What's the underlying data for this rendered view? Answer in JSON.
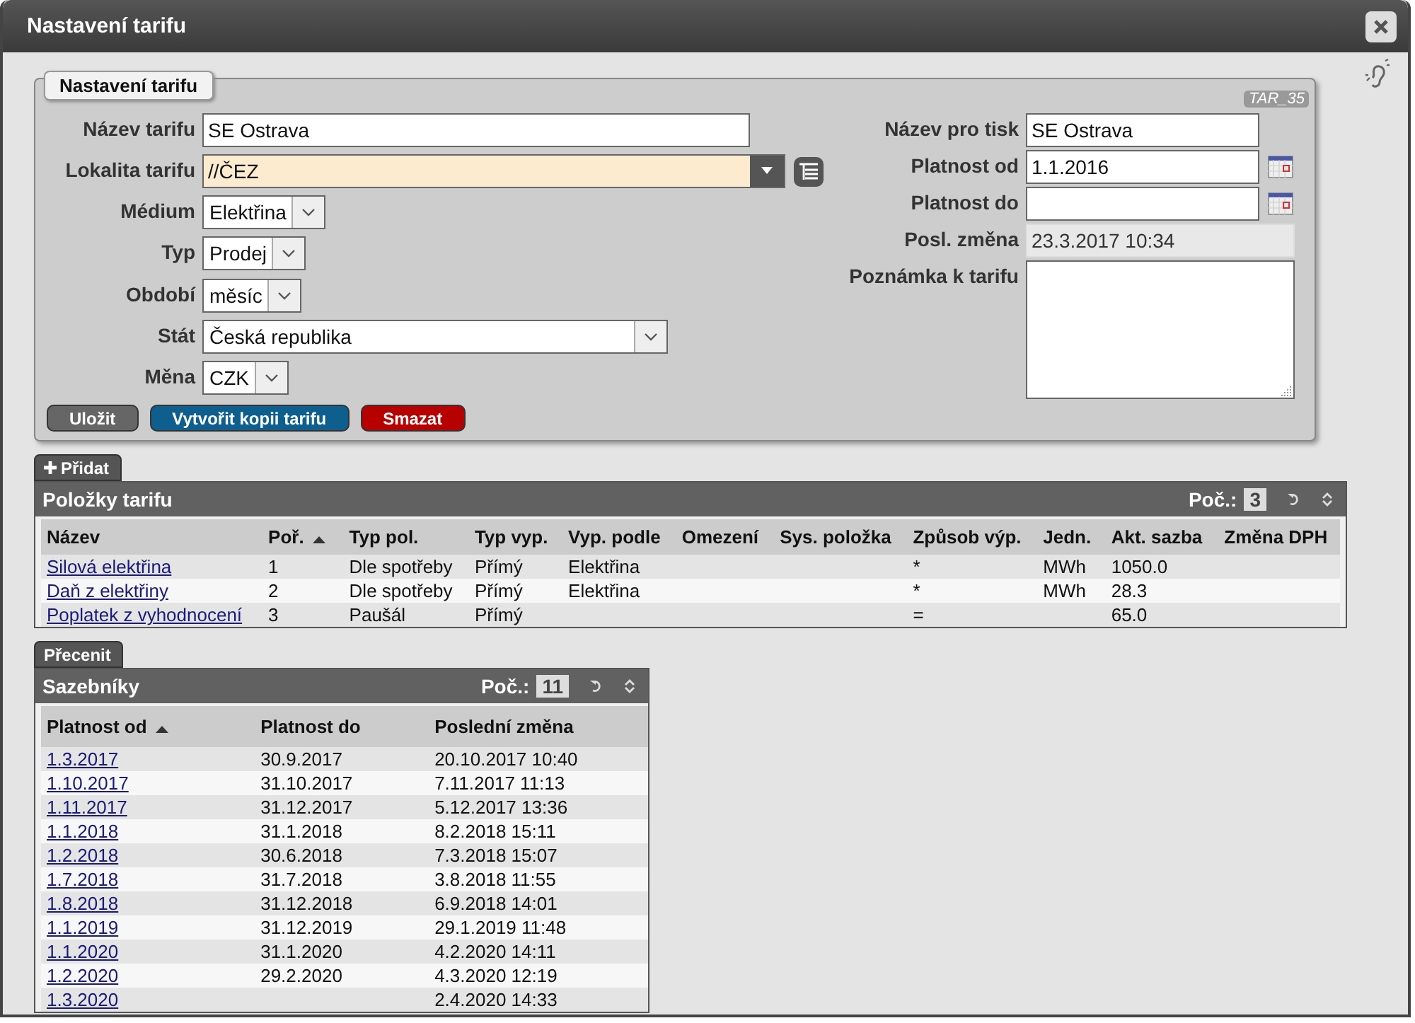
{
  "window": {
    "title": "Nastavení tarifu"
  },
  "panel": {
    "legend": "Nastavení tarifu",
    "code": "TAR_35",
    "left_fields": [
      {
        "label": "Název tarifu",
        "value": "SE Ostrava",
        "kind": "text",
        "highlighted": false
      },
      {
        "label": "Lokalita tarifu",
        "value": "//ČEZ",
        "kind": "combo",
        "highlighted": true
      },
      {
        "label": "Médium",
        "value": "Elektřina",
        "kind": "select",
        "highlighted": false
      },
      {
        "label": "Typ",
        "value": "Prodej",
        "kind": "select",
        "highlighted": false
      },
      {
        "label": "Období",
        "value": "měsíc",
        "kind": "select",
        "highlighted": false
      },
      {
        "label": "Stát",
        "value": "Česká republika",
        "kind": "wideselect",
        "highlighted": false
      },
      {
        "label": "Měna",
        "value": "CZK",
        "kind": "select",
        "highlighted": false
      }
    ],
    "right_fields": [
      {
        "label": "Název pro tisk",
        "value": "SE Ostrava",
        "kind": "text"
      },
      {
        "label": "Platnost od",
        "value": "1.1.2016",
        "kind": "date"
      },
      {
        "label": "Platnost do",
        "kind": "date"
      },
      {
        "label": "Posl. změna",
        "value": "23.3.2017 10:34",
        "kind": "readonly"
      },
      {
        "label": "Poznámka k tarifu",
        "kind": "textarea"
      }
    ],
    "buttons": [
      {
        "label": "Uložit",
        "kind": "neutral"
      },
      {
        "label": "Vytvořit kopii tarifu",
        "kind": "primary"
      },
      {
        "label": "Smazat",
        "kind": "danger"
      }
    ]
  },
  "add_button": "Přidat",
  "items_table": {
    "title": "Položky tarifu",
    "count_label": "Poč.:",
    "count": "3",
    "columns": [
      {
        "label": "Název",
        "sorted": false
      },
      {
        "label": "Poř.",
        "sorted": true
      },
      {
        "label": "Typ pol.",
        "sorted": false
      },
      {
        "label": "Typ vyp.",
        "sorted": false
      },
      {
        "label": "Vyp. podle",
        "sorted": false
      },
      {
        "label": "Omezení",
        "sorted": false
      },
      {
        "label": "Sys. položka",
        "sorted": false
      },
      {
        "label": "Způsob výp.",
        "sorted": false
      },
      {
        "label": "Jedn.",
        "sorted": false
      },
      {
        "label": "Akt. sazba",
        "sorted": false
      },
      {
        "label": "Změna DPH",
        "sorted": false
      }
    ],
    "rows": [
      [
        "Silová elektřina",
        "1",
        "Dle spotřeby",
        "Přímý",
        "Elektřina",
        null,
        null,
        "*",
        "MWh",
        "1050.0",
        null
      ],
      [
        "Daň z elektřiny",
        "2",
        "Dle spotřeby",
        "Přímý",
        "Elektřina",
        null,
        null,
        "*",
        "MWh",
        "28.3",
        null
      ],
      [
        "Poplatek z vyhodnocení",
        "3",
        "Paušál",
        "Přímý",
        null,
        null,
        null,
        "=",
        null,
        "65.0",
        null
      ]
    ]
  },
  "recalc_button": "Přecenit",
  "rates_table": {
    "title": "Sazebníky",
    "count_label": "Poč.:",
    "count": "11",
    "columns": [
      {
        "label": "Platnost od",
        "sorted": true
      },
      {
        "label": "Platnost do",
        "sorted": false
      },
      {
        "label": "Poslední změna",
        "sorted": false
      }
    ],
    "rows": [
      [
        "1.3.2017",
        "30.9.2017",
        "20.10.2017 10:40"
      ],
      [
        "1.10.2017",
        "31.10.2017",
        "7.11.2017 11:13"
      ],
      [
        "1.11.2017",
        "31.12.2017",
        "5.12.2017 13:36"
      ],
      [
        "1.1.2018",
        "31.1.2018",
        "8.2.2018 15:11"
      ],
      [
        "1.2.2018",
        "30.6.2018",
        "7.3.2018 15:07"
      ],
      [
        "1.7.2018",
        "31.7.2018",
        "3.8.2018 11:55"
      ],
      [
        "1.8.2018",
        "31.12.2018",
        "6.9.2018 14:01"
      ],
      [
        "1.1.2019",
        "31.12.2019",
        "29.1.2019 11:48"
      ],
      [
        "1.1.2020",
        "31.1.2020",
        "4.2.2020 14:11"
      ],
      [
        "1.2.2020",
        "29.2.2020",
        "4.3.2020 12:19"
      ],
      [
        "1.3.2020",
        null,
        "2.4.2020 14:33"
      ]
    ]
  }
}
